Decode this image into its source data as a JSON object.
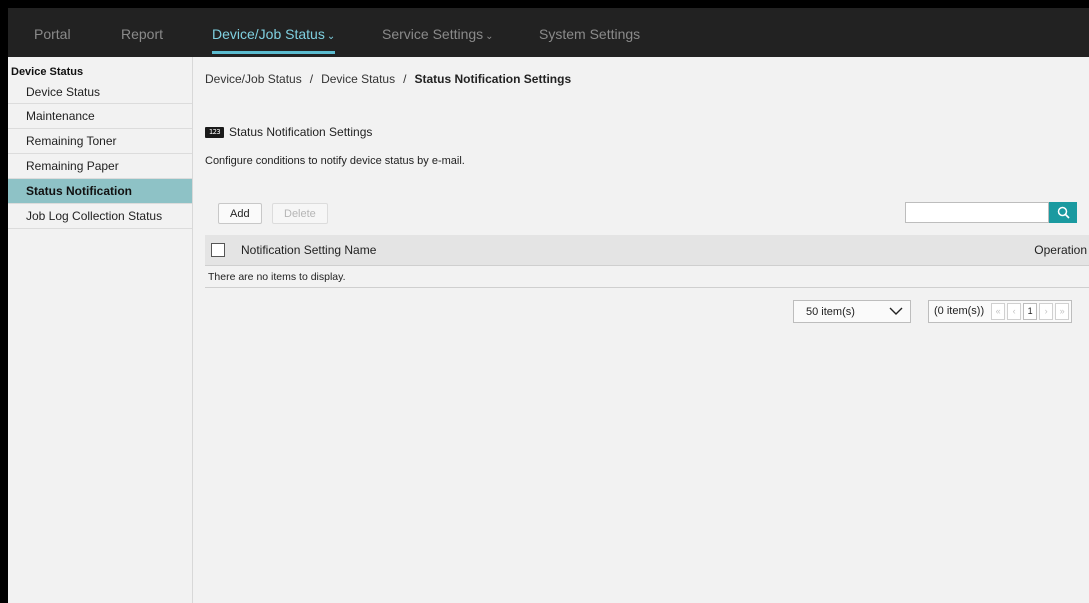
{
  "topnav": {
    "items": [
      {
        "label": "Portal"
      },
      {
        "label": "Report"
      },
      {
        "label": "Device/Job Status",
        "caret": "⌄"
      },
      {
        "label": "Service Settings",
        "caret": "⌄"
      },
      {
        "label": "System Settings"
      }
    ],
    "active_color": "#7fd0e0"
  },
  "sidebar": {
    "group_title": "Device Status",
    "items": [
      {
        "label": "Device Status"
      },
      {
        "label": "Maintenance"
      },
      {
        "label": "Remaining Toner"
      },
      {
        "label": "Remaining Paper"
      },
      {
        "label": "Status Notification"
      },
      {
        "label": "Job Log Collection Status"
      }
    ],
    "selected_color": "#8ec2c6"
  },
  "breadcrumb": {
    "items": [
      "Device/Job Status",
      "Device Status"
    ],
    "separator": "/",
    "current": "Status Notification Settings"
  },
  "page": {
    "title": "Status Notification Settings",
    "icon_text": "123",
    "description": "Configure conditions to notify device status by e-mail."
  },
  "toolbar": {
    "add_label": "Add",
    "delete_label": "Delete",
    "search_value": "",
    "search_icon": "search-icon",
    "accent": "#1a9aa0"
  },
  "table": {
    "columns": [
      "Notification Setting Name",
      "Operation"
    ],
    "empty_message": "There are no items to display."
  },
  "pagination": {
    "page_size": "50 item(s)",
    "total": "(0 item(s))",
    "first": "«",
    "prev": "‹",
    "page": "1",
    "next": "›",
    "last": "»"
  }
}
